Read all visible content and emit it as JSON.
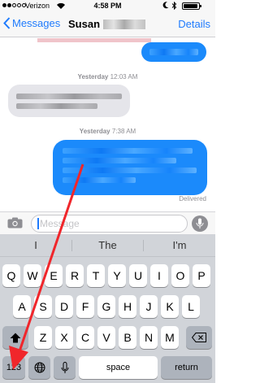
{
  "status_bar": {
    "carrier": "Verizon",
    "time": "4:58 PM",
    "battery_level": 0.85
  },
  "nav": {
    "back_label": "Messages",
    "contact_name": "Susan",
    "details_label": "Details"
  },
  "conversation": {
    "timestamps": [
      {
        "day": "Yesterday",
        "time": "12:03 AM"
      },
      {
        "day": "Yesterday",
        "time": "7:38 AM"
      }
    ],
    "delivered_label": "Delivered"
  },
  "input": {
    "placeholder": "Message"
  },
  "keyboard": {
    "suggestions": [
      "I",
      "The",
      "I'm"
    ],
    "row1": [
      "Q",
      "W",
      "E",
      "R",
      "T",
      "Y",
      "U",
      "I",
      "O",
      "P"
    ],
    "row2": [
      "A",
      "S",
      "D",
      "F",
      "G",
      "H",
      "J",
      "K",
      "L"
    ],
    "row3": [
      "Z",
      "X",
      "C",
      "V",
      "B",
      "N",
      "M"
    ],
    "numbers_label": "123",
    "space_label": "space",
    "return_label": "return"
  },
  "annotation": {
    "arrow_color": "#f0262b"
  },
  "colors": {
    "ios_blue": "#1f7bfd",
    "bubble_blue": "#1b8afb",
    "bubble_gray": "#e5e5ea",
    "keyboard_bg": "#d1d4d9"
  }
}
